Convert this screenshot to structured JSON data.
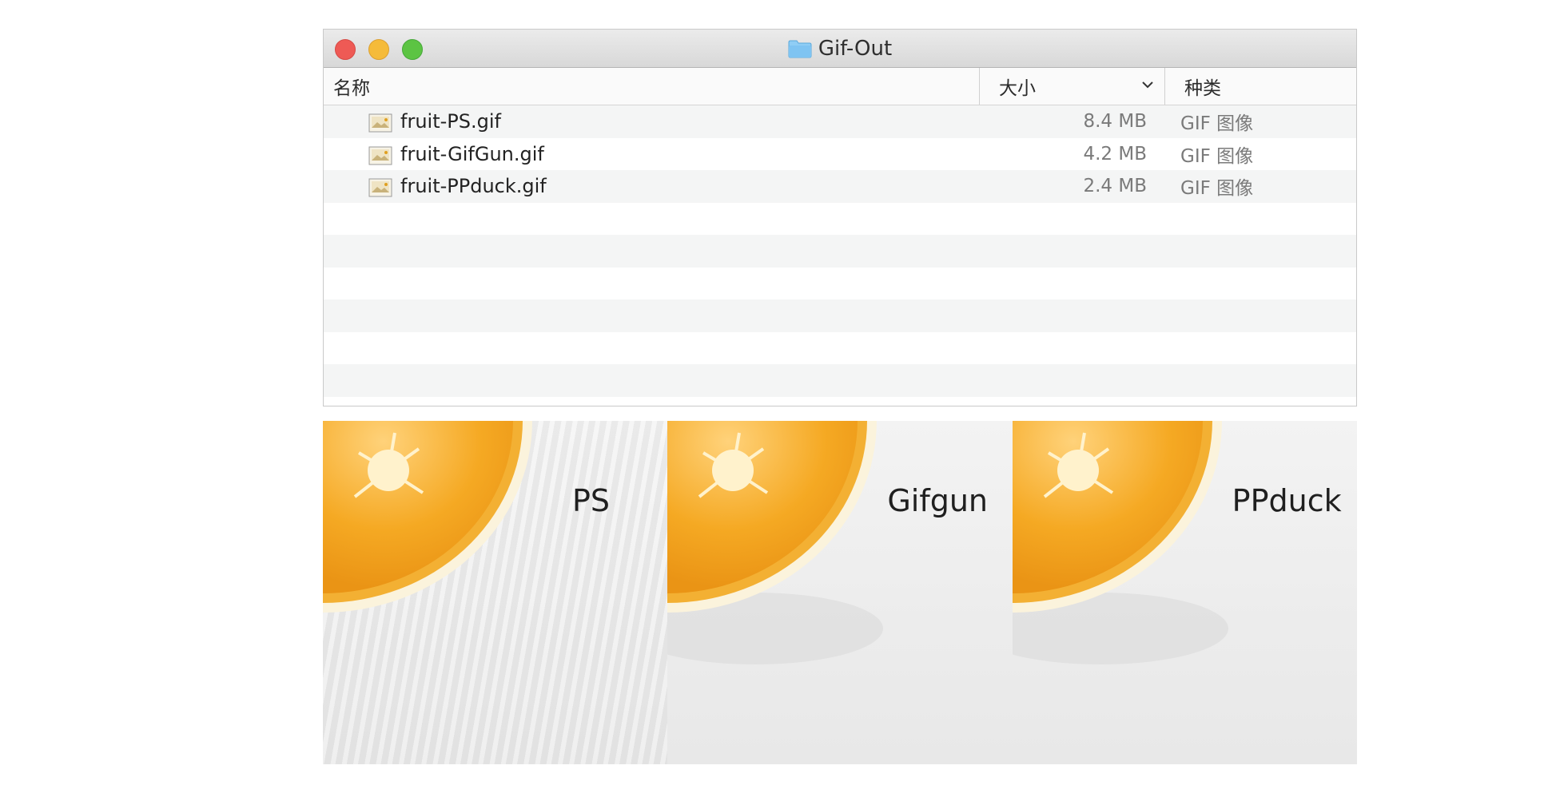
{
  "window": {
    "title": "Gif-Out",
    "columns": {
      "name": "名称",
      "size": "大小",
      "kind": "种类"
    },
    "files": [
      {
        "name": "fruit-PS.gif",
        "size": "8.4 MB",
        "kind": "GIF 图像"
      },
      {
        "name": "fruit-GifGun.gif",
        "size": "4.2 MB",
        "kind": "GIF 图像"
      },
      {
        "name": "fruit-PPduck.gif",
        "size": "2.4 MB",
        "kind": "GIF 图像"
      }
    ],
    "colors": {
      "close": "#ee5a55",
      "minimize": "#f5bb3a",
      "zoom": "#5cc443",
      "folder": "#7fc4f2"
    }
  },
  "previews": [
    {
      "label": "PS"
    },
    {
      "label": "Gifgun"
    },
    {
      "label": "PPduck"
    }
  ],
  "icons": {
    "folder": "folder-icon",
    "file": "gif-file-icon",
    "sort": "chevron-down-icon"
  }
}
